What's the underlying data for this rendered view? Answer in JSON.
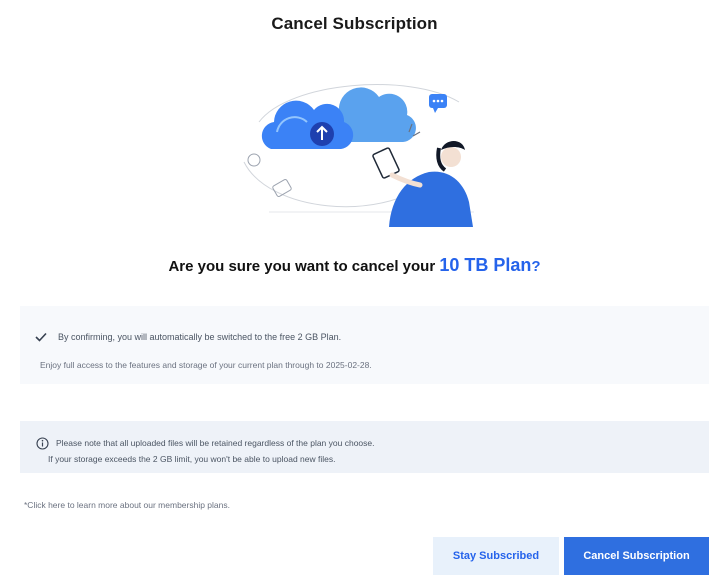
{
  "modal": {
    "title": "Cancel Subscription",
    "question_prefix": "Are you sure you want to cancel your ",
    "plan_name": "10 TB Plan",
    "question_suffix": "?"
  },
  "confirmation": {
    "check_text": "By confirming, you will automatically be switched to the free 2 GB Plan.",
    "enjoy_text": "Enjoy full access to the features and storage of your current plan through to 2025-02-28."
  },
  "notice": {
    "line1": "Please note that all uploaded files will be retained regardless of the plan you choose.",
    "line2": "If your storage exceeds the 2 GB limit, you won't be able to upload new files."
  },
  "membership_link": "*Click here to learn more about our membership plans.",
  "buttons": {
    "stay_label": "Stay Subscribed",
    "cancel_label": "Cancel Subscription"
  },
  "colors": {
    "accent": "#2563eb",
    "primary_button": "#2f6fe0",
    "secondary_button_bg": "#e8f1fb",
    "info_bg": "#f7f9fc",
    "notice_bg": "#eef2f8"
  }
}
